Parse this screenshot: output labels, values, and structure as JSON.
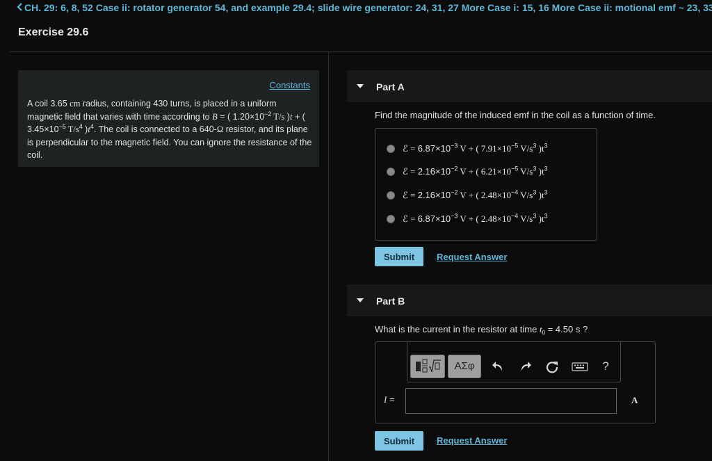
{
  "breadcrumb": "CH. 29: 6, 8, 52 Case ii: rotator generator 54, and example 29.4; slide wire generator: 24, 31, 27 More Case i: 15, 16 More Case ii: motional emf ~ 23, 33",
  "exercise_title": "Exercise 29.6",
  "problem": {
    "constants_link": "Constants",
    "t1": "A coil 3.65 ",
    "unit_cm": "cm",
    "t2": " radius, containing 430 turns, is placed in a uniform magnetic field that varies with time according to ",
    "var_B": "B",
    "t3": " = ( 1.20×10",
    "exp1": "−2",
    "unit_T_s": " T/s",
    "t4": " )",
    "var_t1": "t",
    "t5": " + ( 3.45×10",
    "exp2": "−5",
    "unit_T_s4": " T/s",
    "exp3": "4",
    "t6": " )",
    "var_t2": "t",
    "exp4": "4",
    "t7": ". The coil is connected to a 640-",
    "omega": "Ω",
    "t8": " resistor, and its plane is perpendicular to the magnetic field. You can ignore the resistance of the coil."
  },
  "partA": {
    "label": "Part A",
    "question": "Find the magnitude of the induced emf in the coil as a function of time.",
    "choices": [
      {
        "a": "ℰ = ",
        "b": "6.87×10",
        "c": "−3",
        "d": " V + ( 7.91×10",
        "e": "−5",
        "f": " V/s",
        "g": "3",
        "h": " )t",
        "i": "3"
      },
      {
        "a": "ℰ = ",
        "b": "2.16×10",
        "c": "−2",
        "d": " V + ( 6.21×10",
        "e": "−5",
        "f": " V/s",
        "g": "3",
        "h": " )t",
        "i": "3"
      },
      {
        "a": "ℰ = ",
        "b": "2.16×10",
        "c": "−2",
        "d": " V + ( 2.48×10",
        "e": "−4",
        "f": " V/s",
        "g": "3",
        "h": " )t",
        "i": "3"
      },
      {
        "a": "ℰ = ",
        "b": "6.87×10",
        "c": "−3",
        "d": " V + ( 2.48×10",
        "e": "−4",
        "f": " V/s",
        "g": "3",
        "h": " )t",
        "i": "3"
      }
    ],
    "submit": "Submit",
    "request": "Request Answer"
  },
  "partB": {
    "label": "Part B",
    "q1": "What is the current in the resistor at time ",
    "q_var": "t",
    "q_sub": "0",
    "q2": " = 4.50 s ?",
    "toolbar": {
      "templates_icon": "fraction-root-template-icon",
      "symbols_label": "ΑΣφ",
      "undo_icon": "undo-icon",
      "redo_icon": "redo-icon",
      "reset_icon": "reset-icon",
      "keyboard_icon": "keyboard-icon",
      "help_label": "?"
    },
    "input_label": "I",
    "input_eq": " =",
    "input_value": "",
    "unit": "A",
    "submit": "Submit",
    "request": "Request Answer"
  }
}
